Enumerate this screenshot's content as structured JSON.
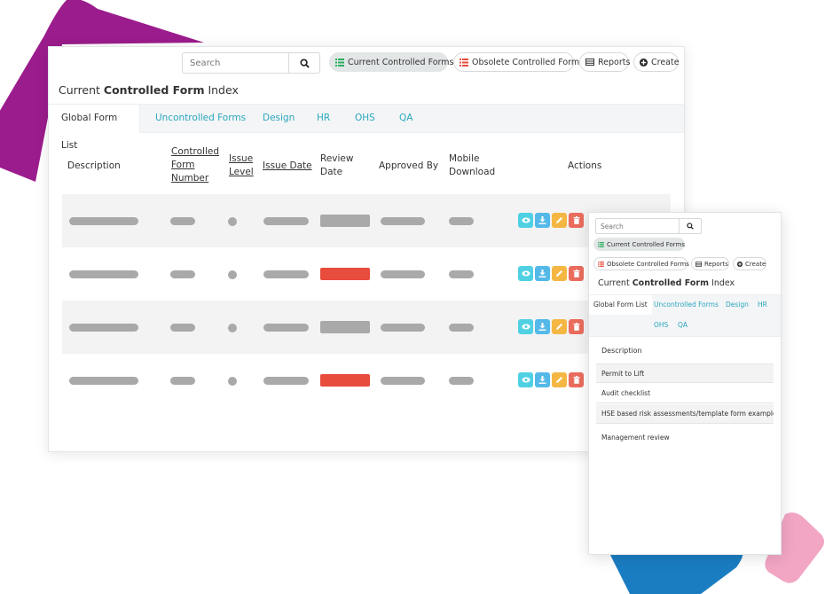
{
  "colors": {
    "accent_teal": "#2aa7bf",
    "review_grey": "#a9a9a9",
    "review_red": "#e74c3c",
    "btn_view": "#4fd1e3",
    "btn_download": "#54b9e8",
    "btn_edit": "#f4b744",
    "btn_delete": "#ea6c5d",
    "blob_purple": "#9b1c8c",
    "blob_blue": "#1a7dc2",
    "blob_pink": "#f2a6c4"
  },
  "main": {
    "search_placeholder": "Search",
    "buttons": {
      "current_label": "Current Controlled Forms",
      "obsolete_label": "Obsolete Controlled Forms",
      "reports_label": "Reports",
      "create_label": "Create"
    },
    "title_prefix": "Current ",
    "title_bold": "Controlled Form",
    "title_suffix": " Index",
    "tabs": [
      "Global Form List",
      "Uncontrolled Forms",
      "Design",
      "HR",
      "OHS",
      "QA"
    ],
    "columns": {
      "description": "Description",
      "controlled_form_number": [
        "Controlled",
        "Form",
        "Number"
      ],
      "issue_level": [
        "Issue",
        "Level"
      ],
      "issue_date": "Issue Date",
      "review_date": [
        "Review",
        "Date"
      ],
      "approved_by": "Approved By",
      "mobile_download": [
        "Mobile",
        "Download"
      ],
      "actions": "Actions"
    },
    "rows": [
      {
        "review_status": "grey"
      },
      {
        "review_status": "red"
      },
      {
        "review_status": "grey"
      },
      {
        "review_status": "red"
      }
    ],
    "action_icons": [
      "eye-icon",
      "download-icon",
      "pencil-icon",
      "trash-icon"
    ]
  },
  "small": {
    "search_placeholder": "Search",
    "buttons": {
      "current_label": "Current Controlled Forms",
      "obsolete_label": "Obsolete Controlled Forms",
      "reports_label": "Reports",
      "create_label": "Create"
    },
    "title_prefix": "Current ",
    "title_bold": "Controlled Form",
    "title_suffix": " Index",
    "tabs": [
      "Global Form List",
      "Uncontrolled Forms",
      "Design",
      "HR",
      "OHS",
      "QA"
    ],
    "column_description": "Description",
    "rows": [
      "Permit to Lift",
      "Audit checklist",
      "HSE based risk assessments/template form examples",
      "Management review"
    ]
  }
}
